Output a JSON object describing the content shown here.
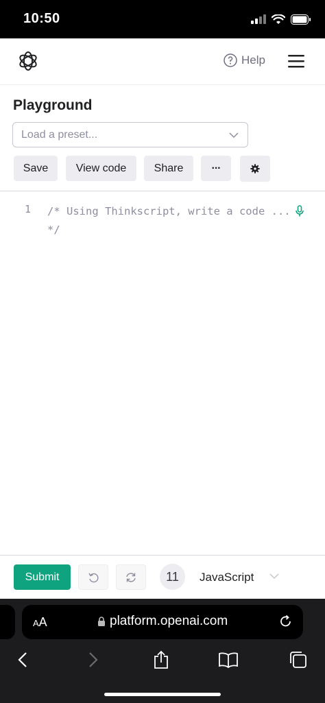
{
  "status_bar": {
    "time": "10:50"
  },
  "header": {
    "help_label": "Help"
  },
  "page": {
    "title": "Playground"
  },
  "preset": {
    "placeholder": "Load a preset..."
  },
  "toolbar": {
    "save_label": "Save",
    "view_code_label": "View code",
    "share_label": "Share",
    "more_label": "···"
  },
  "editor": {
    "line_number": "1",
    "code_text": "/* Using Thinkscript, write a code ...\n*/"
  },
  "footer": {
    "submit_label": "Submit",
    "token_count": "11",
    "language": "JavaScript"
  },
  "browser": {
    "text_size_label_small": "A",
    "text_size_label_large": "A",
    "url": "platform.openai.com"
  },
  "colors": {
    "accent": "#10a37f",
    "button_bg": "#ececf1",
    "muted_text": "#8e8ea0"
  },
  "icons": [
    "openai-logo-icon",
    "help-circle-icon",
    "hamburger-menu-icon",
    "chevron-down-icon",
    "gear-icon",
    "microphone-icon",
    "undo-icon",
    "redo-icon",
    "lock-icon",
    "reload-icon",
    "back-icon",
    "forward-icon",
    "share-icon",
    "bookmarks-icon",
    "tabs-icon"
  ]
}
